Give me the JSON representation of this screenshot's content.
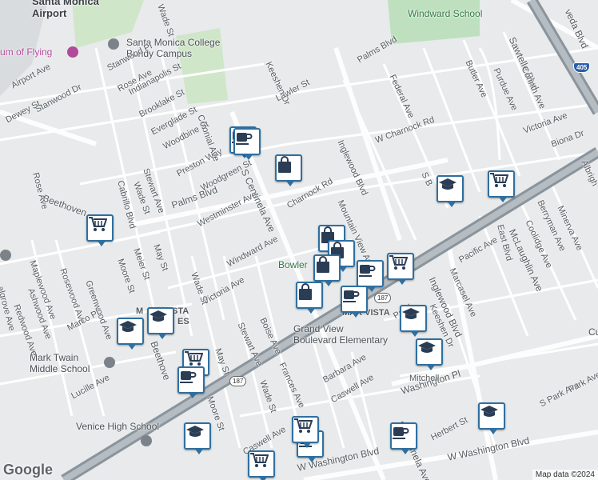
{
  "map": {
    "labels": {
      "santa_monica_airport": "Santa Monica\nAirport",
      "museum_of_flying": "um of Flying",
      "smc_bundy": "Santa Monica College\nBundy Campus",
      "windward_school": "Windward School",
      "grand_view": "Grand View\nBoulevard Elementary",
      "mark_twain": "Mark Twain\nMiddle School",
      "venice_high": "Venice High School",
      "bowlero": "Bowler",
      "mar_vista": "MAR VISTA",
      "mar_vista_left": "M",
      "mar_vista_left2": "ISTA",
      "mar_vista_left3": "ES",
      "cut_right": "Cu"
    },
    "streets": {
      "palms_blvd": "Palms Blvd",
      "palms_blvd2": "Palms Blvd",
      "centinela": "S Centinela Ave",
      "centinela2": "S Centinela Ave",
      "sawtelle": "Sawtelle Blvd",
      "inglewood": "Inglewood Blvd",
      "inglewood2": "Inglewood Blvd",
      "mclaughlin": "McLaughlin Ave",
      "washington_pl": "Washington Pl",
      "w_washington": "W Washington Blvd",
      "w_washington2": "W Washington Blvd",
      "beethoven": "Beethoven",
      "beethoven2": "Beethove",
      "w_charnock": "W Charnock Rd",
      "charnock": "Charnock Rd",
      "mountain_view": "Mountain View Ave",
      "federal": "Federal Ave",
      "butler": "Butler Ave",
      "purdue": "Purdue Ave",
      "corinth": "Corinth Ave",
      "victoria": "Victoria Ave",
      "victoria2": "Victoria Ave",
      "biona": "Biona Dr",
      "albright": "Albrigh",
      "minerva": "Minerva Ave",
      "beryman": "Berryman Ave",
      "coolidge": "Coolidge Ave",
      "east_blvd": "East Blvd",
      "pacific": "Pacific Ave",
      "pacific2": "Pacif",
      "marcasel": "Marcasel Ave",
      "keeshen": "Keeshen Dr",
      "keeshen2": "Keeshen Dr",
      "mitchell": "Mitchell",
      "barbara": "Barbara Ave",
      "caswell": "Caswell Ave",
      "caswell2": "Caswell Ave",
      "frances": "Frances Ave",
      "boise": "Boise Ave",
      "stewart": "Stewart Ave",
      "stewart2": "Stewart Ave",
      "wade": "Wade St",
      "wade2": "Wade St",
      "wade3": "Wade St",
      "windward": "Windward Ave",
      "westminster": "Westminster Ave",
      "woodgreen": "Woodgreen St",
      "preston": "Preston Way",
      "colonial": "Colonial Ave",
      "woodbine": "Woodbine St",
      "everglade": "Everglade St",
      "brooklake": "Brooklake St",
      "indianapolis": "Indianapolis St",
      "rose": "Rose Ave",
      "rose2": "Rose Ave",
      "stanwood": "Stanwood Pl",
      "stanwood_dr": "Stanwood Dr",
      "airport": "Airport Ave",
      "dewey": "Dewey St",
      "cabrillo": "Cabrillo Blvd",
      "moore": "Moore St",
      "moore2": "Moore St",
      "meier": "Meier St",
      "may": "May St",
      "may2": "May St",
      "greenwood": "Greenwood Ave",
      "rosewood": "Rosewood Ave",
      "maplewood": "Maplewood Ave",
      "ashwood": "Ashwood Ave",
      "redwood": "Redwood Ave",
      "marco": "Marco Pl",
      "walgrove": "algrove Ave",
      "lucille": "Lucille Ave",
      "lawler": "Lawler St",
      "palms_blvd_n": "Palms Blvd",
      "herbert": "Herbert St",
      "s_park": "S Park Ave",
      "park_ave": "Park Ave",
      "venice_blvd_top": "veda Blvd",
      "wade_top": "Wade St",
      "s_b": "S B"
    },
    "shields": {
      "i405": "405",
      "r187": "187",
      "r187b": "187"
    },
    "pins": [
      {
        "icon": "coffee"
      },
      {
        "icon": "shopping-bag"
      },
      {
        "icon": "shopping-cart"
      },
      {
        "icon": "graduation-cap"
      },
      {
        "icon": "shopping-cart"
      },
      {
        "icon": "shopping-bag"
      },
      {
        "icon": "shopping-bag"
      },
      {
        "icon": "coffee"
      },
      {
        "icon": "shopping-cart"
      },
      {
        "icon": "shopping-bag"
      },
      {
        "icon": "coffee"
      },
      {
        "icon": "coffee"
      },
      {
        "icon": "graduation-cap"
      },
      {
        "icon": "graduation-cap"
      },
      {
        "icon": "graduation-cap"
      },
      {
        "icon": "graduation-cap"
      },
      {
        "icon": "shopping-cart"
      },
      {
        "icon": "coffee"
      },
      {
        "icon": "graduation-cap"
      },
      {
        "icon": "shopping-cart"
      },
      {
        "icon": "coffee"
      },
      {
        "icon": "coffee"
      },
      {
        "icon": "graduation-cap"
      },
      {
        "icon": "shopping-cart"
      },
      {
        "icon": "shopping-bag"
      }
    ],
    "attribution": "Map data ©2024",
    "logo": "Google"
  }
}
